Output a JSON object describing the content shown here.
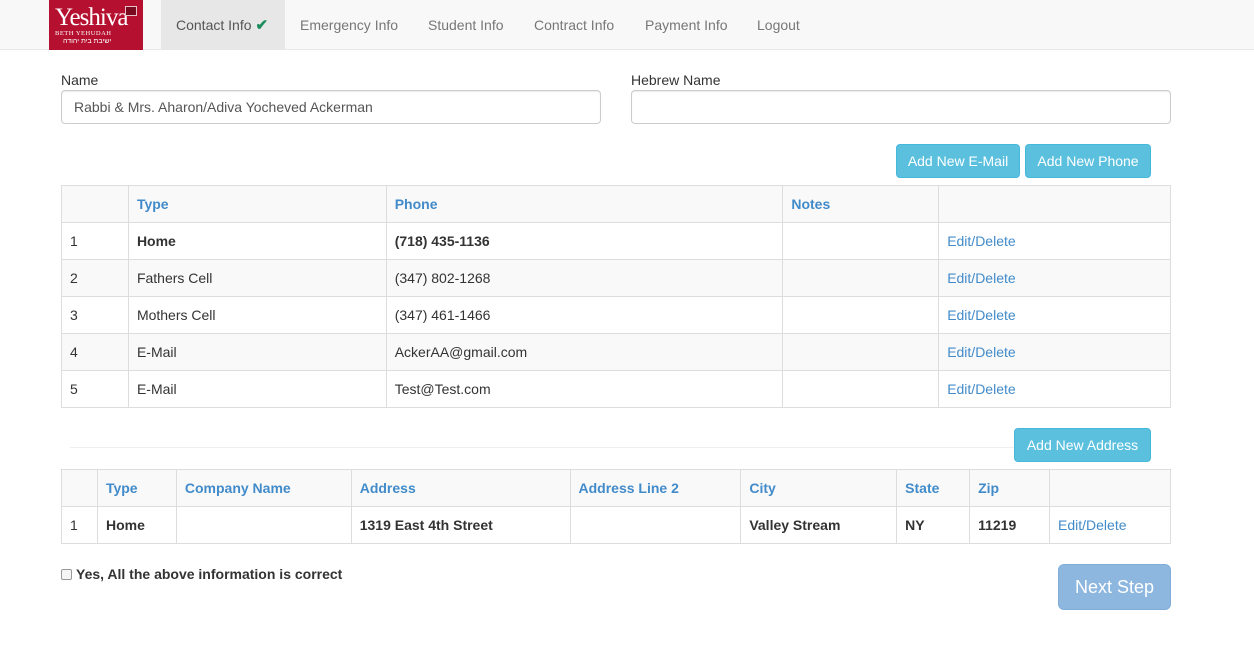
{
  "brand": {
    "main": "Yeshiva",
    "sub": "BETH YEHUDAH",
    "hebrew": "ישיבת בית יהודה"
  },
  "nav": {
    "items": [
      {
        "label": "Contact Info",
        "active": true
      },
      {
        "label": "Emergency Info"
      },
      {
        "label": "Student Info"
      },
      {
        "label": "Contract Info"
      },
      {
        "label": "Payment Info"
      },
      {
        "label": "Logout"
      }
    ],
    "check_icon": "✔"
  },
  "form": {
    "name_label": "Name",
    "name_value": "Rabbi & Mrs. Aharon/Adiva Yocheved Ackerman",
    "hebrew_label": "Hebrew Name",
    "hebrew_value": ""
  },
  "buttons": {
    "add_email": "Add New E-Mail",
    "add_phone": "Add New Phone",
    "add_address": "Add New Address",
    "next_step": "Next Step"
  },
  "phones": {
    "headers": [
      "",
      "Type",
      "Phone",
      "Notes",
      ""
    ],
    "rows": [
      {
        "num": "1",
        "type": "Home",
        "phone": "(718) 435-1136",
        "notes": "",
        "action": "Edit/Delete"
      },
      {
        "num": "2",
        "type": "Fathers Cell",
        "phone": "(347) 802-1268",
        "notes": "",
        "action": "Edit/Delete"
      },
      {
        "num": "3",
        "type": "Mothers Cell",
        "phone": "(347) 461-1466",
        "notes": "",
        "action": "Edit/Delete"
      },
      {
        "num": "4",
        "type": "E-Mail",
        "phone": "AckerAA@gmail.com",
        "notes": "",
        "action": "Edit/Delete"
      },
      {
        "num": "5",
        "type": "E-Mail",
        "phone": "Test@Test.com",
        "notes": "",
        "action": "Edit/Delete"
      }
    ]
  },
  "addresses": {
    "headers": [
      "",
      "Type",
      "Company Name",
      "Address",
      "Address Line 2",
      "City",
      "State",
      "Zip",
      ""
    ],
    "rows": [
      {
        "num": "1",
        "type": "Home",
        "company": "",
        "address": "1319 East 4th Street",
        "address2": "",
        "city": "Valley Stream",
        "state": "NY",
        "zip": "11219",
        "action": "Edit/Delete"
      }
    ]
  },
  "confirm_label": "Yes, All the above information is correct",
  "colors": {
    "brand": "#b5102f",
    "link": "#428bca",
    "info": "#5bc0de",
    "check": "#1e8d5e"
  }
}
